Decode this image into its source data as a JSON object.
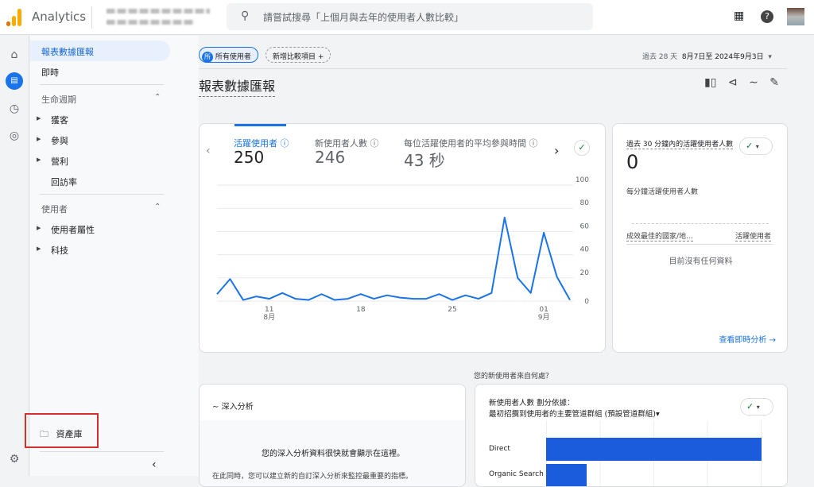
{
  "topbar": {
    "brand": "Analytics",
    "search_placeholder": "請嘗試搜尋「上個月與去年的使用者人數比較」",
    "icons": [
      "apps-icon",
      "help-icon",
      "avatar"
    ]
  },
  "rail": {
    "icons": [
      "home-icon",
      "reports-icon",
      "explore-icon",
      "advertising-icon",
      "settings-icon"
    ]
  },
  "nav": {
    "selected": "報表數據匯報",
    "realtime": "即時",
    "lifecycle": {
      "title": "生命週期",
      "items": [
        "獲客",
        "參與",
        "營利",
        "回訪率"
      ]
    },
    "user": {
      "title": "使用者",
      "items": [
        "使用者屬性",
        "科技"
      ]
    },
    "library": "資產庫"
  },
  "header": {
    "segment_badge": "所",
    "segment": "所有使用者",
    "add_comparison": "新增比較項目",
    "date_prefix": "過去 28 天",
    "date_range": "8月7日至 2024年9月3日",
    "title": "報表數據匯報"
  },
  "metrics": [
    {
      "label": "活躍使用者",
      "value": "250"
    },
    {
      "label": "新使用者人數",
      "value": "246"
    },
    {
      "label": "每位活躍使用者的平均參與時間",
      "value": "43 秒"
    }
  ],
  "chart_data": {
    "type": "line",
    "x": [
      "8/7",
      "8/8",
      "8/9",
      "8/10",
      "8/11",
      "8/12",
      "8/13",
      "8/14",
      "8/15",
      "8/16",
      "8/17",
      "8/18",
      "8/19",
      "8/20",
      "8/21",
      "8/22",
      "8/23",
      "8/24",
      "8/25",
      "8/26",
      "8/27",
      "8/28",
      "8/29",
      "8/30",
      "8/31",
      "9/1",
      "9/2",
      "9/3"
    ],
    "values": [
      6,
      19,
      1,
      4,
      2,
      7,
      2,
      1,
      6,
      1,
      2,
      6,
      2,
      5,
      3,
      2,
      2,
      6,
      1,
      5,
      2,
      7,
      72,
      20,
      7,
      59,
      21,
      1
    ],
    "yticks": [
      "100",
      "80",
      "60",
      "40",
      "20",
      "0"
    ],
    "xticks": [
      {
        "day": "11",
        "month": "8月"
      },
      {
        "day": "18"
      },
      {
        "day": "25"
      },
      {
        "day": "01",
        "month": "9月"
      }
    ],
    "ylim": [
      0,
      100
    ],
    "grid": true,
    "color": "#1a73e8"
  },
  "realtime": {
    "title": "過去 30 分鐘內的活躍使用者人數",
    "value": "0",
    "per_minute": "每分鐘活躍使用者人數",
    "col1": "成效最佳的國家/地...",
    "col2": "活躍使用者",
    "empty": "目前沒有任何資料",
    "link": "查看即時分析"
  },
  "where_title": "您的新使用者來自何處？",
  "insights": {
    "title": "深入分析",
    "message": "您的深入分析資料很快就會顯示在這裡。",
    "body": "在此同時，您可以建立新的自訂深入分析來監控最重要的指標。"
  },
  "acquisition": {
    "title_line1": "新使用者人數 劃分依據：",
    "title_line2": "最初招攬到使用者的主要管道群組 (預設管道群組)",
    "rows": [
      {
        "label": "Direct",
        "fraction": 1.0
      },
      {
        "label": "Organic Search",
        "fraction": 0.19
      }
    ]
  },
  "colors": {
    "accent": "#1a73e8",
    "bar": "#1a5cdc",
    "highlight": "#d32f2f"
  }
}
